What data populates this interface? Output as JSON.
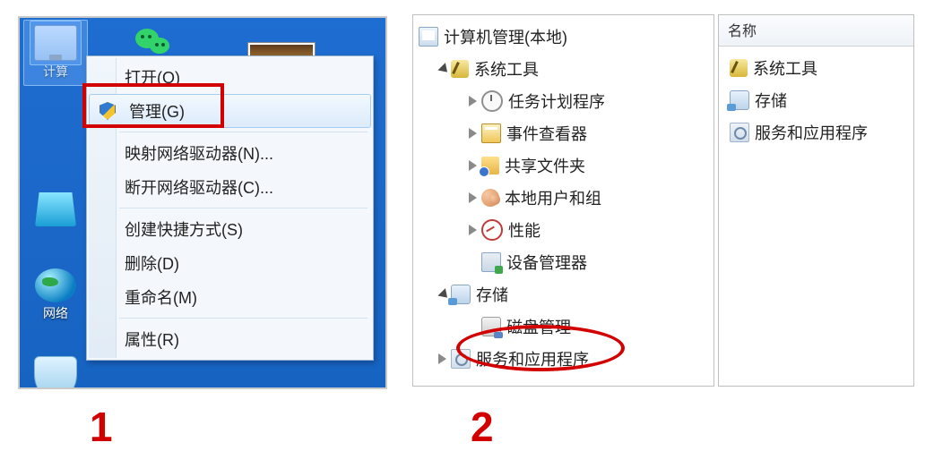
{
  "step_numbers": {
    "one": "1",
    "two": "2"
  },
  "desktop": {
    "icons": {
      "computer": "计算",
      "network": "网络"
    }
  },
  "context_menu": {
    "open": "打开(O)",
    "manage": "管理(G)",
    "map_drive": "映射网络驱动器(N)...",
    "disc_drive": "断开网络驱动器(C)...",
    "shortcut": "创建快捷方式(S)",
    "delete": "删除(D)",
    "rename": "重命名(M)",
    "properties": "属性(R)"
  },
  "mgmt_tree": {
    "root": "计算机管理(本地)",
    "sys_tools": "系统工具",
    "task_sched": "任务计划程序",
    "event_viewer": "事件查看器",
    "shared": "共享文件夹",
    "local_users": "本地用户和组",
    "performance": "性能",
    "dev_mgr": "设备管理器",
    "storage": "存储",
    "disk_mgmt": "磁盘管理",
    "services": "服务和应用程序"
  },
  "right_pane": {
    "header": "名称",
    "items": {
      "sys_tools": "系统工具",
      "storage": "存储",
      "services": "服务和应用程序"
    }
  }
}
